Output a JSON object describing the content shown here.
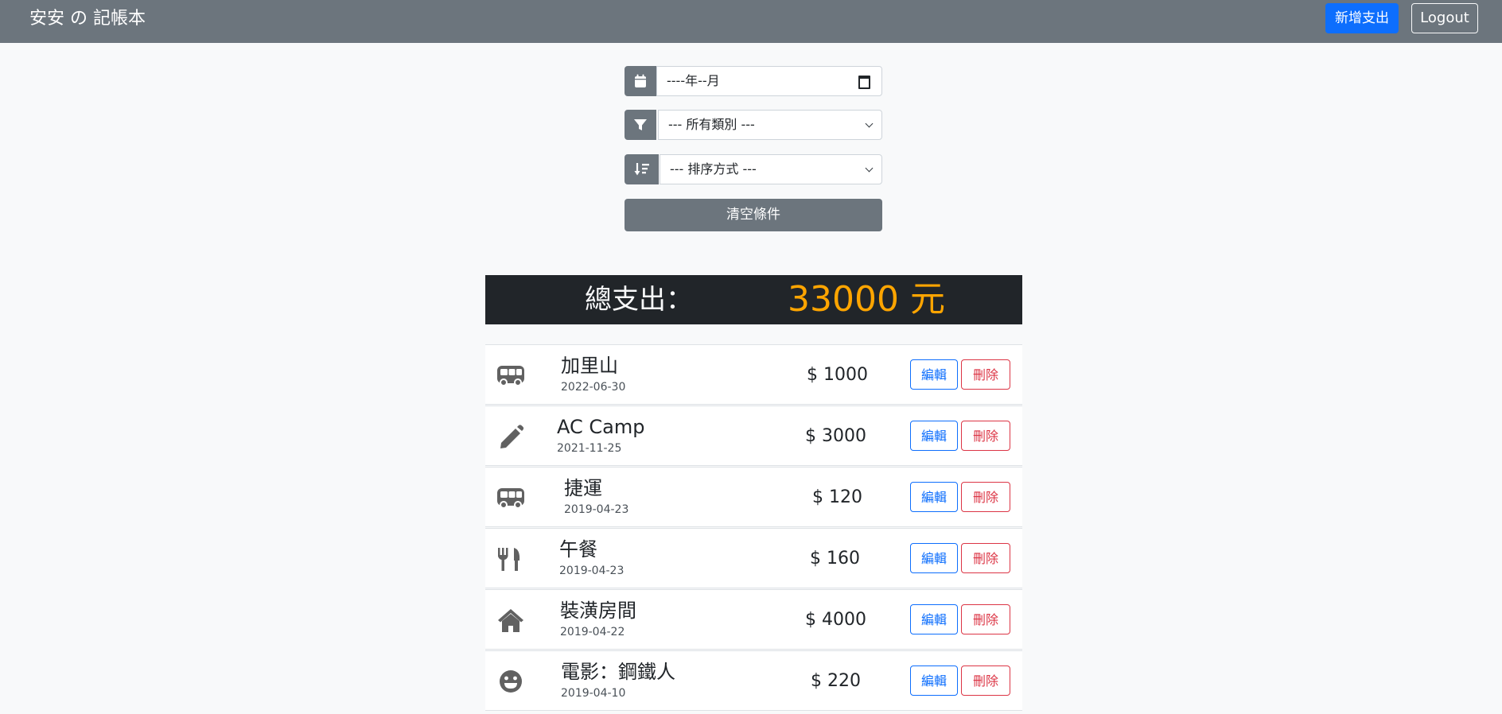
{
  "navbar": {
    "brand": "安安 の 記帳本",
    "add_label": "新增支出",
    "logout_label": "Logout"
  },
  "filters": {
    "month_value": "----年--月",
    "category_value": "--- 所有類別 ---",
    "sort_value": "--- 排序方式 ---",
    "clear_label": "清空條件"
  },
  "summary": {
    "label": "總支出：",
    "amount": "33000 元",
    "amount_color": "#ffa500"
  },
  "records": [
    {
      "icon": "bus-icon",
      "name": "加里山",
      "date": "2022-06-30",
      "amount": "$ 1000",
      "edit": "編輯",
      "delete": "刪除"
    },
    {
      "icon": "pencil-icon",
      "name": "AC Camp",
      "date": "2021-11-25",
      "amount": "$ 3000",
      "edit": "編輯",
      "delete": "刪除"
    },
    {
      "icon": "bus-icon",
      "name": "捷運",
      "date": "2019-04-23",
      "amount": "$ 120",
      "edit": "編輯",
      "delete": "刪除"
    },
    {
      "icon": "utensils-icon",
      "name": "午餐",
      "date": "2019-04-23",
      "amount": "$ 160",
      "edit": "編輯",
      "delete": "刪除"
    },
    {
      "icon": "home-icon",
      "name": "裝潢房間",
      "date": "2019-04-22",
      "amount": "$ 4000",
      "edit": "編輯",
      "delete": "刪除"
    },
    {
      "icon": "smile-icon",
      "name": "電影：鋼鐵人",
      "date": "2019-04-10",
      "amount": "$ 220",
      "edit": "編輯",
      "delete": "刪除"
    }
  ]
}
